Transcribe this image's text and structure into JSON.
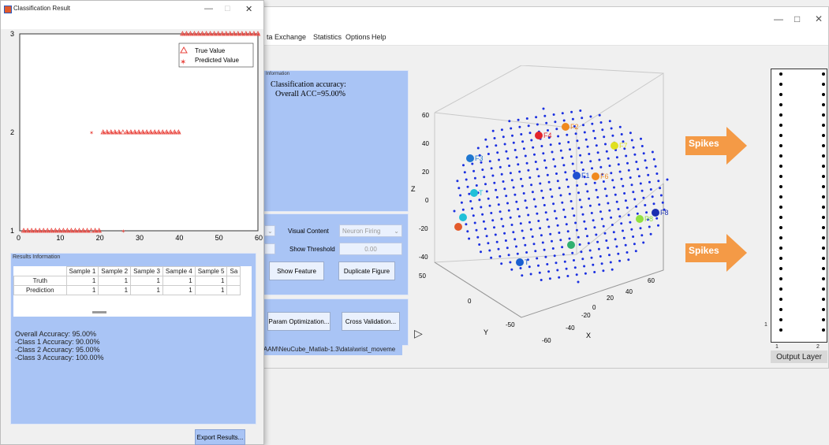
{
  "main_window": {
    "controls": {
      "minimize": "—",
      "maximize": "□",
      "close": "✕"
    },
    "menu": [
      "ta Exchange",
      "Statistics",
      "Options",
      "Help"
    ],
    "info_panel": {
      "title": "Information",
      "line1": "Classification accuracy:",
      "line2": "Overall ACC=95.00%"
    },
    "viz_panel": {
      "visual_content_label": "Visual Content",
      "visual_content_value": "Neuron Firing",
      "show_threshold_label": "Show Threshold",
      "show_threshold_value": "0.00",
      "show_feature_button": "Show Feature",
      "duplicate_figure_button": "Duplicate Figure"
    },
    "opt_panel": {
      "param_optimization_button": "Param Optimization...",
      "cross_validation_button": "Cross Validation..."
    },
    "path_text": "AAM\\NeuCube_Matlab-1.3\\data\\wrist_moveme",
    "plot3d": {
      "z_label": "Z",
      "x_label": "X",
      "y_label": "Y",
      "z_ticks": [
        "60",
        "40",
        "20",
        "0",
        "-20",
        "-40"
      ],
      "x_ticks": [
        "-60",
        "-40",
        "-20",
        "0",
        "20",
        "40",
        "60"
      ],
      "y_ticks": [
        "50",
        "0",
        "-50"
      ],
      "feature_labels": [
        "F4",
        "F2",
        "F3",
        "F7",
        "F6",
        "F8",
        "T",
        "F1",
        "P8",
        "T"
      ]
    },
    "arrows": {
      "top": "Spikes",
      "bottom": "Spikes"
    },
    "output_layer": {
      "title": "Output Layer",
      "x_ticks": [
        "1",
        "2"
      ],
      "y_tick": "1"
    }
  },
  "classification_window": {
    "title": "Classification Result",
    "controls": {
      "minimize": "—",
      "maximize": "□",
      "close": "✕"
    },
    "legend": {
      "true_label": "True Value",
      "pred_label": "Predicted Value"
    },
    "results_title": "Results Information",
    "table": {
      "columns": [
        "",
        "Sample 1",
        "Sample 2",
        "Sample 3",
        "Sample 4",
        "Sample 5",
        "Sa"
      ],
      "rows": [
        {
          "label": "Truth",
          "values": [
            "1",
            "1",
            "1",
            "1",
            "1"
          ]
        },
        {
          "label": "Prediction",
          "values": [
            "1",
            "1",
            "1",
            "1",
            "1"
          ]
        }
      ]
    },
    "accuracy": {
      "overall": "Overall Accuracy: 95.00%",
      "class1": "-Class 1 Accuracy: 90.00%",
      "class2": "-Class 2 Accuracy: 95.00%",
      "class3": "-Class 3 Accuracy: 100.00%"
    },
    "export_button": "Export Results..."
  },
  "chart_data": {
    "type": "scatter",
    "x_ticks": [
      "0",
      "10",
      "20",
      "30",
      "40",
      "50",
      "60"
    ],
    "y_ticks": [
      "1",
      "2",
      "3"
    ],
    "xlim": [
      0,
      60
    ],
    "ylim": [
      1,
      3
    ],
    "legend_position": "top-right",
    "series": [
      {
        "name": "True Value",
        "marker": "triangle",
        "color": "#e8413a",
        "x": [
          1,
          2,
          3,
          4,
          5,
          6,
          7,
          8,
          9,
          10,
          11,
          12,
          13,
          14,
          15,
          16,
          17,
          18,
          19,
          20,
          21,
          22,
          23,
          24,
          25,
          26,
          27,
          28,
          29,
          30,
          31,
          32,
          33,
          34,
          35,
          36,
          37,
          38,
          39,
          40,
          41,
          42,
          43,
          44,
          45,
          46,
          47,
          48,
          49,
          50,
          51,
          52,
          53,
          54,
          55,
          56,
          57,
          58,
          59,
          60
        ],
        "y": [
          1,
          1,
          1,
          1,
          1,
          1,
          1,
          1,
          1,
          1,
          1,
          1,
          1,
          1,
          1,
          1,
          1,
          1,
          1,
          1,
          2,
          2,
          2,
          2,
          2,
          2,
          2,
          2,
          2,
          2,
          2,
          2,
          2,
          2,
          2,
          2,
          2,
          2,
          2,
          2,
          3,
          3,
          3,
          3,
          3,
          3,
          3,
          3,
          3,
          3,
          3,
          3,
          3,
          3,
          3,
          3,
          3,
          3,
          3,
          3
        ]
      },
      {
        "name": "Predicted Value",
        "marker": "star",
        "color": "#e8413a",
        "x": [
          1,
          2,
          3,
          4,
          5,
          6,
          7,
          8,
          9,
          10,
          11,
          12,
          13,
          14,
          15,
          16,
          17,
          18,
          19,
          20,
          21,
          22,
          23,
          24,
          25,
          26,
          27,
          28,
          29,
          30,
          31,
          32,
          33,
          34,
          35,
          36,
          37,
          38,
          39,
          40,
          41,
          42,
          43,
          44,
          45,
          46,
          47,
          48,
          49,
          50,
          51,
          52,
          53,
          54,
          55,
          56,
          57,
          58,
          59,
          60
        ],
        "y": [
          1,
          1,
          1,
          1,
          1,
          1,
          1,
          1,
          1,
          1,
          1,
          1,
          1,
          1,
          1,
          1,
          1,
          2,
          1,
          1,
          2,
          2,
          2,
          2,
          2,
          1,
          2,
          2,
          2,
          2,
          2,
          2,
          2,
          2,
          2,
          2,
          2,
          2,
          2,
          2,
          3,
          3,
          3,
          3,
          3,
          3,
          3,
          3,
          3,
          3,
          3,
          3,
          3,
          3,
          3,
          3,
          3,
          3,
          3,
          3
        ]
      }
    ]
  }
}
